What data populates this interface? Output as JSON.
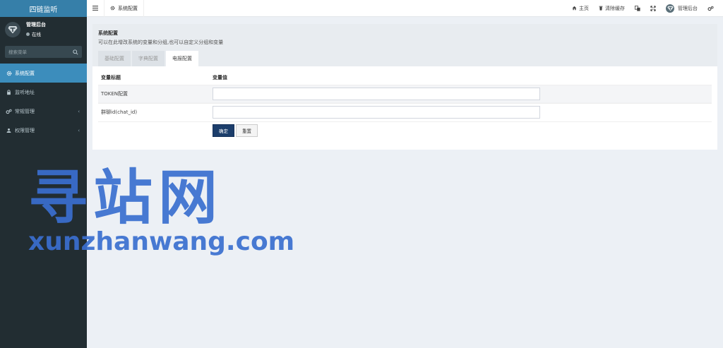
{
  "app": {
    "logo_text": "四链监听"
  },
  "user": {
    "name": "管理后台",
    "status": "在线"
  },
  "sidebar": {
    "search_placeholder": "搜索菜单",
    "items": [
      {
        "label": "系统配置",
        "icon": "gear-icon",
        "active": true,
        "has_arrow": false
      },
      {
        "label": "监听地址",
        "icon": "lock-icon",
        "active": false,
        "has_arrow": false
      },
      {
        "label": "常规管理",
        "icon": "cogs-icon",
        "active": false,
        "has_arrow": true
      },
      {
        "label": "权限管理",
        "icon": "group-icon",
        "active": false,
        "has_arrow": true
      }
    ],
    "arrow": "‹"
  },
  "topbar": {
    "current_tab": "系统配置",
    "links": {
      "home": "主页",
      "clear_cache": "清除缓存",
      "admin": "管理后台"
    }
  },
  "panel": {
    "title": "系统配置",
    "description": "可以在此增改系统的变量和分组,也可以自定义分组和变量",
    "tabs": [
      "基础配置",
      "字典配置",
      "电报配置"
    ],
    "active_tab": 2,
    "table": {
      "headers": [
        "变量标题",
        "变量值"
      ],
      "rows": [
        {
          "label": "TOKEN配置",
          "value": ""
        },
        {
          "label": "群聊id(chat_id)",
          "value": ""
        }
      ]
    },
    "buttons": {
      "confirm": "确定",
      "reset": "重置"
    }
  },
  "watermark": {
    "big": "寻站网",
    "small": "xunzhanwang.com"
  },
  "colors": {
    "sidebar_bg": "#222d32",
    "accent": "#3c8dbc",
    "logo_bg": "#367fa9",
    "primary_button": "#1c3e6b",
    "watermark": "#3a6fd0"
  }
}
